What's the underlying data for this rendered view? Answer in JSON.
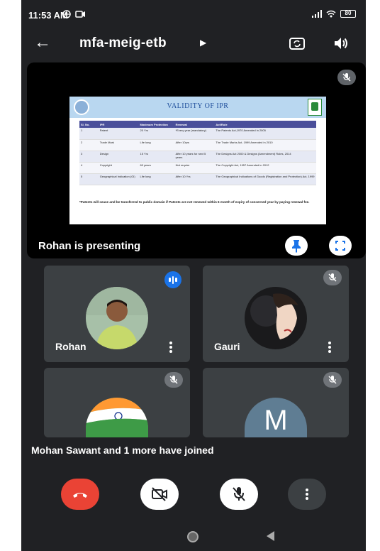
{
  "status_bar": {
    "time": "11:53 AM",
    "battery": "80"
  },
  "header": {
    "meeting_code": "mfa-meig-etb"
  },
  "presentation": {
    "slide_title": "VALIDITY OF IPR",
    "table_headers": [
      "Sl. No.",
      "IPR",
      "Maximum Protection",
      "Renewal",
      "Act/Rule"
    ],
    "table_rows": [
      [
        "1",
        "Patent",
        "20 Yrs",
        "*Every year (mandatory)",
        "The Patents Act,1970 Amended in 2005"
      ],
      [
        "2",
        "Trade Mark",
        "Life long",
        "After 10yrs",
        "The Trade Marks Act, 1999 Amended in 2010"
      ],
      [
        "3",
        "Design",
        "15 Yrs",
        "After 10 years for next 5 years",
        "The Designs Act 2000 & Designs (Amendment) Rules, 2014"
      ],
      [
        "4",
        "Copyright",
        "60 years",
        "Not require",
        "The Copyright Act, 1957 Amended in 2012"
      ],
      [
        "5",
        "Geographical Indication (GI)",
        "Life long",
        "After 10 Yrs",
        "The Geographical Indications of Goods (Registration and Protection) Act, 1999"
      ]
    ],
    "slide_note": "*Patents will cease and be transferred to public domain if Patents are not renewed within 6 month of expiry of concerned year by paying renewal fee.",
    "presenting_label": "Rohan is presenting"
  },
  "participants": [
    {
      "name": "Rohan",
      "initial": ""
    },
    {
      "name": "Gauri",
      "initial": ""
    },
    {
      "name": "",
      "initial": ""
    },
    {
      "name": "",
      "initial": "M"
    }
  ],
  "notification": "Mohan Sawant and 1 more have joined",
  "colors": {
    "end_call": "#ea4335",
    "speaking": "#1a73e8",
    "tile_bg": "#3c4043",
    "app_bg": "#202124"
  }
}
